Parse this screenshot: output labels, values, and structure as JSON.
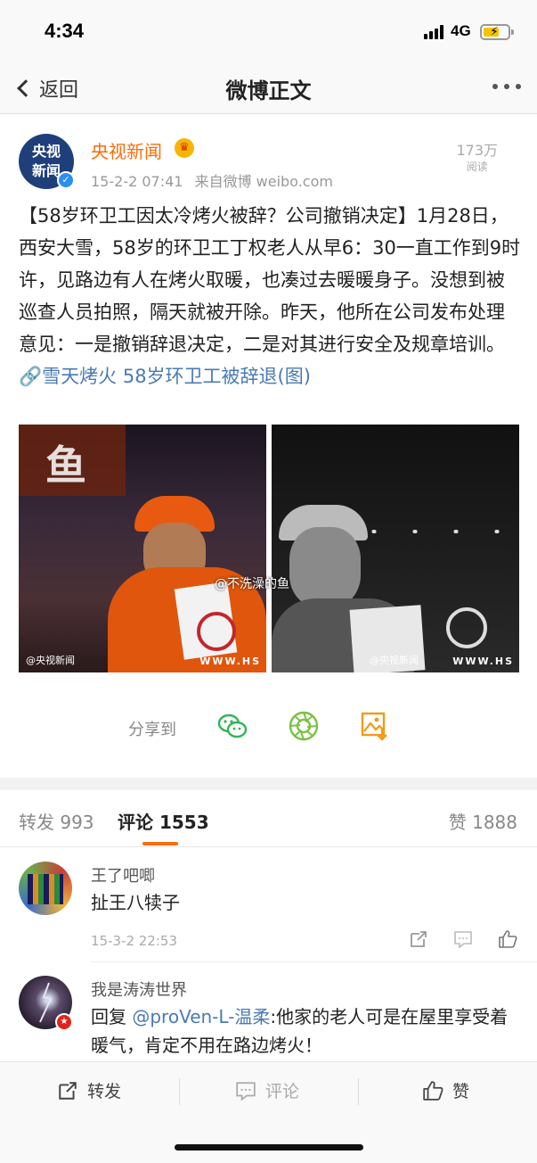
{
  "status_bar": {
    "time": "4:34",
    "network": "4G"
  },
  "nav": {
    "back_label": "返回",
    "title": "微博正文"
  },
  "post": {
    "author": "央视新闻",
    "avatar_text_1": "央视",
    "avatar_text_2": "新闻",
    "timestamp": "15-2-2 07:41",
    "source": "来自微博 weibo.com",
    "read_count": "173万",
    "read_label": "阅读",
    "text": "【58岁环卫工因太冷烤火被辞？公司撤销决定】1月28日，西安大雪，58岁的环卫工丁权老人从早6：30一直工作到9时许，见路边有人在烤火取暖，也凑过去暖暖身子。没想到被巡查人员拍照，隔天就被开除。昨天，他所在公司发布处理意见：一是撤销辞退决定，二是对其进行安全及规章培训。",
    "link_text": "雪天烤火 58岁环卫工被辞退(图)",
    "photos": [
      {
        "caption": "@央视新闻",
        "watermark": "WWW.HS",
        "sign": "鱼"
      },
      {
        "caption": "@央视新闻",
        "watermark": "WWW.HS"
      }
    ],
    "photo_overlay": "@不洗澡的鱼"
  },
  "share": {
    "label": "分享到",
    "targets": [
      "wechat-icon",
      "moments-icon",
      "save-image-icon"
    ]
  },
  "tabs": {
    "repost_label": "转发",
    "repost_count": "993",
    "comment_label": "评论",
    "comment_count": "1553",
    "like_label": "赞",
    "like_count": "1888"
  },
  "comments": [
    {
      "name": "王了吧唧",
      "text": "扯王八犊子",
      "time": "15-3-2 22:53"
    },
    {
      "name": "我是涛涛世界",
      "reply_prefix": "回复 ",
      "mention": "@proVen-L-温柔",
      "text": ":他家的老人可是在屋里享受着暖气，肯定不用在路边烤火！"
    }
  ],
  "bottom_bar": {
    "repost": "转发",
    "comment": "评论",
    "like": "赞"
  },
  "colors": {
    "accent": "#f86e0b",
    "link": "#4a7ab5"
  }
}
